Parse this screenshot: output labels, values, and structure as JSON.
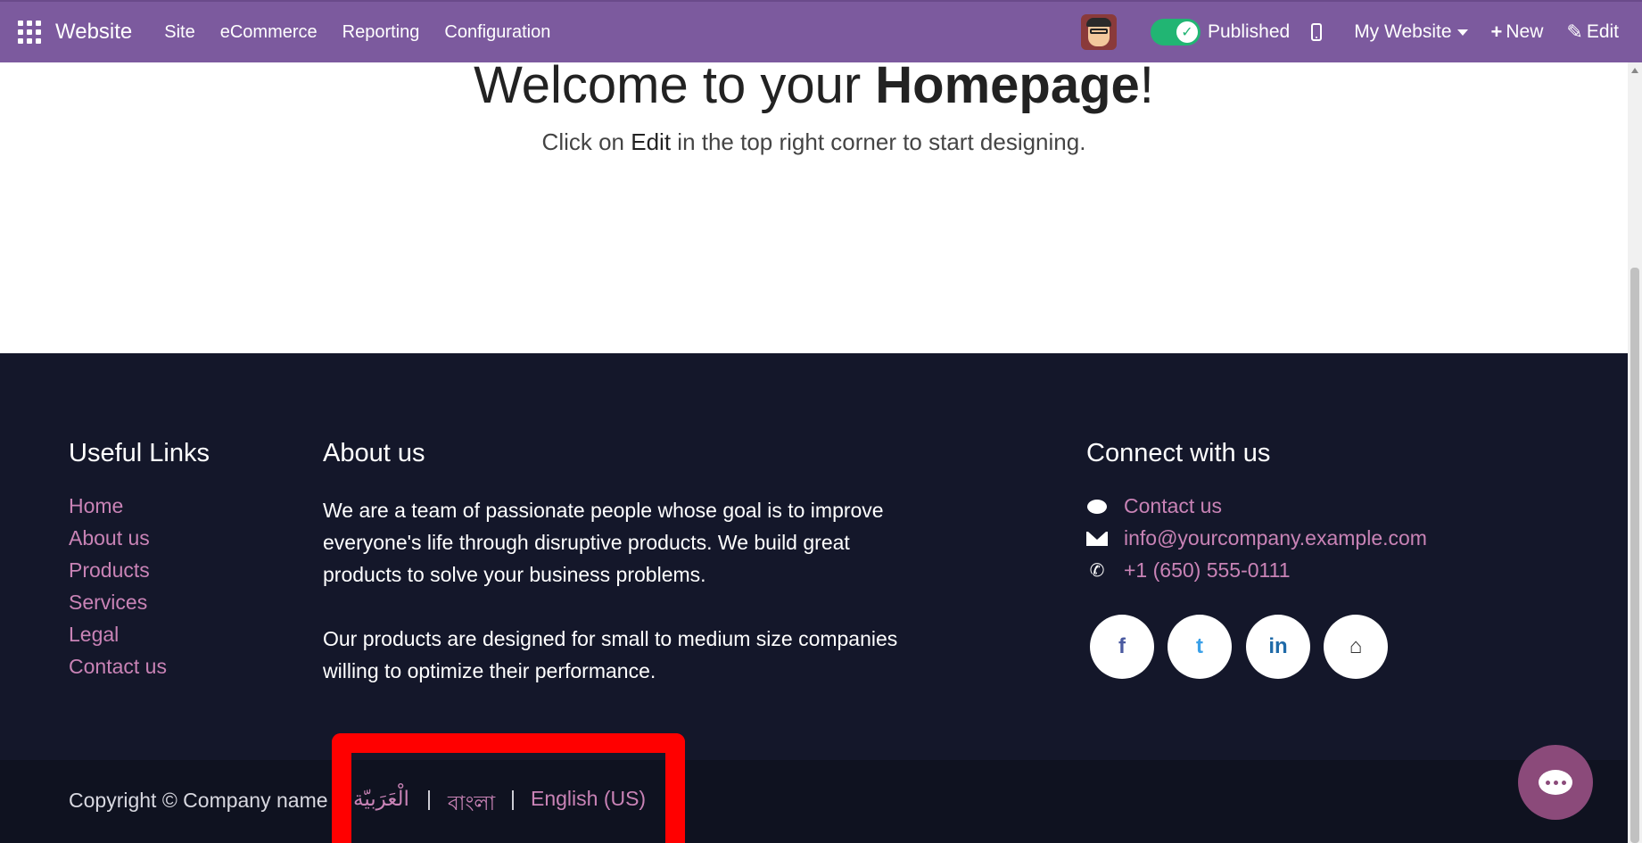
{
  "navbar": {
    "brand": "Website",
    "menu": [
      "Site",
      "eCommerce",
      "Reporting",
      "Configuration"
    ],
    "published_label": "Published",
    "published_toggle": "on",
    "website_selector": "My Website",
    "new_label": "New",
    "edit_label": "Edit",
    "accent_color": "#7c5a9e"
  },
  "hero": {
    "title_prefix": "Welcome to your ",
    "title_bold": "Homepage",
    "title_suffix": "!",
    "subtitle_prefix": "Click on ",
    "subtitle_bold": "Edit",
    "subtitle_suffix": " in the top right corner to start designing."
  },
  "footer": {
    "useful_links_title": "Useful Links",
    "useful_links": [
      "Home",
      "About us",
      "Products",
      "Services",
      "Legal",
      "Contact us"
    ],
    "about_title": "About us",
    "about_paragraphs": [
      "We are a team of passionate people whose goal is to improve everyone's life through disruptive products. We build great products to solve your business problems.",
      "Our products are designed for small to medium size companies willing to optimize their performance."
    ],
    "connect_title": "Connect with us",
    "contact": {
      "contact_label": "Contact us",
      "email": "info@yourcompany.example.com",
      "phone": "+1 (650) 555-0111"
    },
    "social_icons": [
      "facebook-icon",
      "twitter-icon",
      "linkedin-icon",
      "home-icon"
    ],
    "social_glyphs": [
      "f",
      "t",
      "in",
      "⌂"
    ],
    "background_color": "#14172a",
    "link_color": "#c983b6"
  },
  "copyright": {
    "text": "Copyright © Company name",
    "languages": [
      "الْعَرَبيّة",
      "বাংলা",
      "English (US)"
    ],
    "separator": "|"
  }
}
